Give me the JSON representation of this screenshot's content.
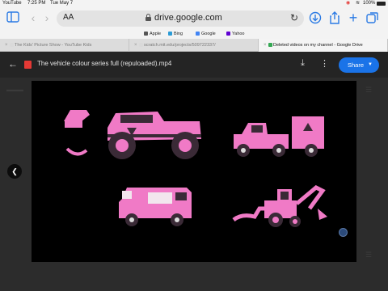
{
  "status_bar": {
    "app": "YouTube",
    "time": "7:25 PM",
    "date": "Tue May 7",
    "battery": "100%"
  },
  "browser": {
    "url": "drive.google.com",
    "aa_label": "AA",
    "favorites": [
      "Apple",
      "Bing",
      "Google",
      "Yahoo"
    ],
    "tabs": [
      {
        "label": "The Kids' Picture Show - YouTube Kids",
        "active": false
      },
      {
        "label": "scratch.mit.edu/projects/509722337/",
        "active": false
      },
      {
        "label": "Deleted videos on my channel - Google Drive",
        "active": true
      }
    ]
  },
  "drive_viewer": {
    "file_title": "The vehicle colour series full (repuloaded).mp4",
    "share_label": "Share"
  },
  "video": {
    "vehicles": [
      "pink monster truck",
      "pink pickup truck with trailer",
      "pink ice cream truck",
      "pink backhoe loader"
    ]
  },
  "colors": {
    "accent": "#1a73e8",
    "vehicle_pink": "#f07ac6",
    "vehicle_dark": "#3a2a36"
  },
  "icons": [
    "sidebar-icon",
    "back-icon",
    "forward-icon",
    "lock-icon",
    "reload-icon",
    "download-icon",
    "share-icon",
    "new-tab-icon",
    "tabs-icon",
    "more-icon"
  ]
}
